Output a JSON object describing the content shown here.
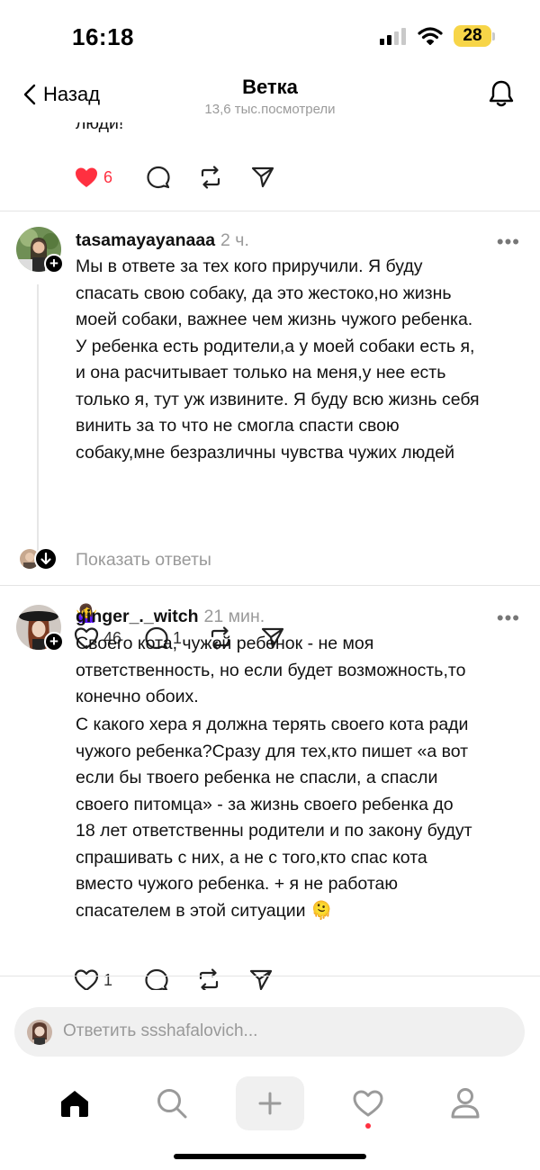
{
  "status_bar": {
    "time": "16:18",
    "battery": "28"
  },
  "header": {
    "back_label": "Назад",
    "title": "Ветка",
    "views": "13,6 тыс.посмотрели"
  },
  "prev_post": {
    "text_tail": "люди!",
    "likes": "6"
  },
  "posts": [
    {
      "username": "tasamayayanaaa",
      "time": "2 ч.",
      "text": "Мы в ответе за тех кого приручили. Я буду\nспасать свою собаку, да это жестоко,но жизнь\nмоей собаки, важнее чем жизнь чужого ребенка.\nУ ребенка есть родители,а у моей собаки есть я,\nи она расчитывает только на меня,у нее есть\nтолько я, тут уж извините. Я буду всю жизнь себя\nвинить за то что не смогла спасти свою\nсобаку,мне безразличны чувства чужих людей",
      "emoji": "🤷‍♀️",
      "likes": "46",
      "replies": "1",
      "show_replies": "Показать ответы"
    },
    {
      "username": "ginger_._witch",
      "time": "21 мин.",
      "text": "Своего кота, чужой ребенок - не моя\nответственность, но если будет возможность,то\nконечно обоих.",
      "text2": "С какого хера я должна терять своего кота ради\nчужого ребенка?Сразу для тех,кто пишет «а вот\nесли бы твоего ребенка не спасли, а спасли\nсвоего питомца» - за жизнь своего ребенка до\n18 лет ответственны родители и по закону будут\nспрашивать с них, а не с того,кто спас кота\nвместо чужого ребенка. + я не работаю\nспасателем в этой ситуации",
      "emoji": "🫠",
      "likes": "1"
    }
  ],
  "reply_bar": {
    "placeholder": "Ответить ssshafalovich..."
  },
  "icons": {
    "back": "chevron-left-icon",
    "bell": "bell-icon",
    "heart": "heart-icon",
    "comment": "comment-icon",
    "repost": "repost-icon",
    "share": "share-icon",
    "more": "more-icon",
    "home": "home-icon",
    "search": "search-icon",
    "create": "plus-icon",
    "activity": "heart-icon",
    "profile": "profile-icon"
  },
  "colors": {
    "like": "#ff3040",
    "muted": "#9a9a9a",
    "battery": "#f7d548"
  }
}
